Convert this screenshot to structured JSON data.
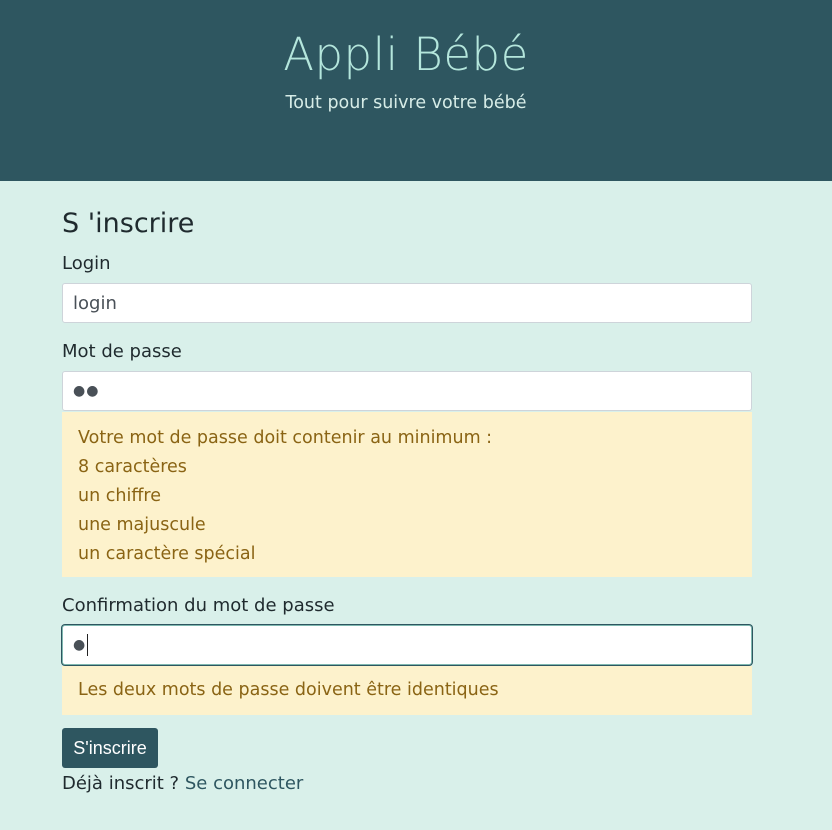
{
  "header": {
    "title": "Appli Bébé",
    "subtitle": "Tout pour suivre votre bébé"
  },
  "form": {
    "title": "S 'inscrire",
    "login": {
      "label": "Login",
      "value": "login"
    },
    "password": {
      "label": "Mot de passe",
      "masked_value": "●●",
      "hint_lines": [
        "Votre mot de passe doit contenir au minimum :",
        "8 caractères",
        "un chiffre",
        "une majuscule",
        "un caractère spécial"
      ]
    },
    "confirm": {
      "label": "Confirmation du mot de passe",
      "masked_value": "●",
      "hint": "Les deux mots de passe doivent être identiques"
    },
    "submit_label": "S'inscrire",
    "already_text": "Déjà inscrit ?",
    "login_link": "Se connecter"
  },
  "colors": {
    "header_bg": "#2e5660",
    "page_bg": "#d9f0ea",
    "alert_bg": "#fdf2cc",
    "alert_text": "#8a6414"
  }
}
